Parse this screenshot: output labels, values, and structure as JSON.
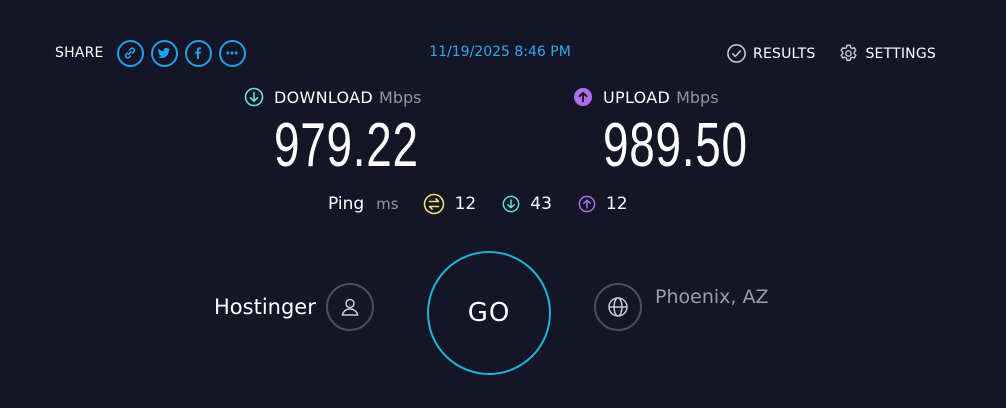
{
  "share": {
    "label": "SHARE",
    "buttons": [
      {
        "name": "link-icon"
      },
      {
        "name": "twitter-icon"
      },
      {
        "name": "facebook-icon"
      },
      {
        "name": "more-icon"
      }
    ]
  },
  "timestamp": "11/19/2025 8:46 PM",
  "nav": {
    "results_label": "RESULTS",
    "settings_label": "SETTINGS"
  },
  "download": {
    "title": "DOWNLOAD",
    "unit": "Mbps",
    "value": "979.22",
    "color": "#65e3d9"
  },
  "upload": {
    "title": "UPLOAD",
    "unit": "Mbps",
    "value": "989.50",
    "color": "#b06fe8"
  },
  "ping": {
    "label": "Ping",
    "unit": "ms",
    "idle": "12",
    "download": "43",
    "upload": "12",
    "idle_color": "#f2e171"
  },
  "go": {
    "label": "GO"
  },
  "isp": {
    "name": "Hostinger"
  },
  "server": {
    "location": "Phoenix, AZ"
  },
  "colors": {
    "background": "#141526",
    "accent": "#1fa1ec",
    "go_ring": "#1cb3d8"
  }
}
